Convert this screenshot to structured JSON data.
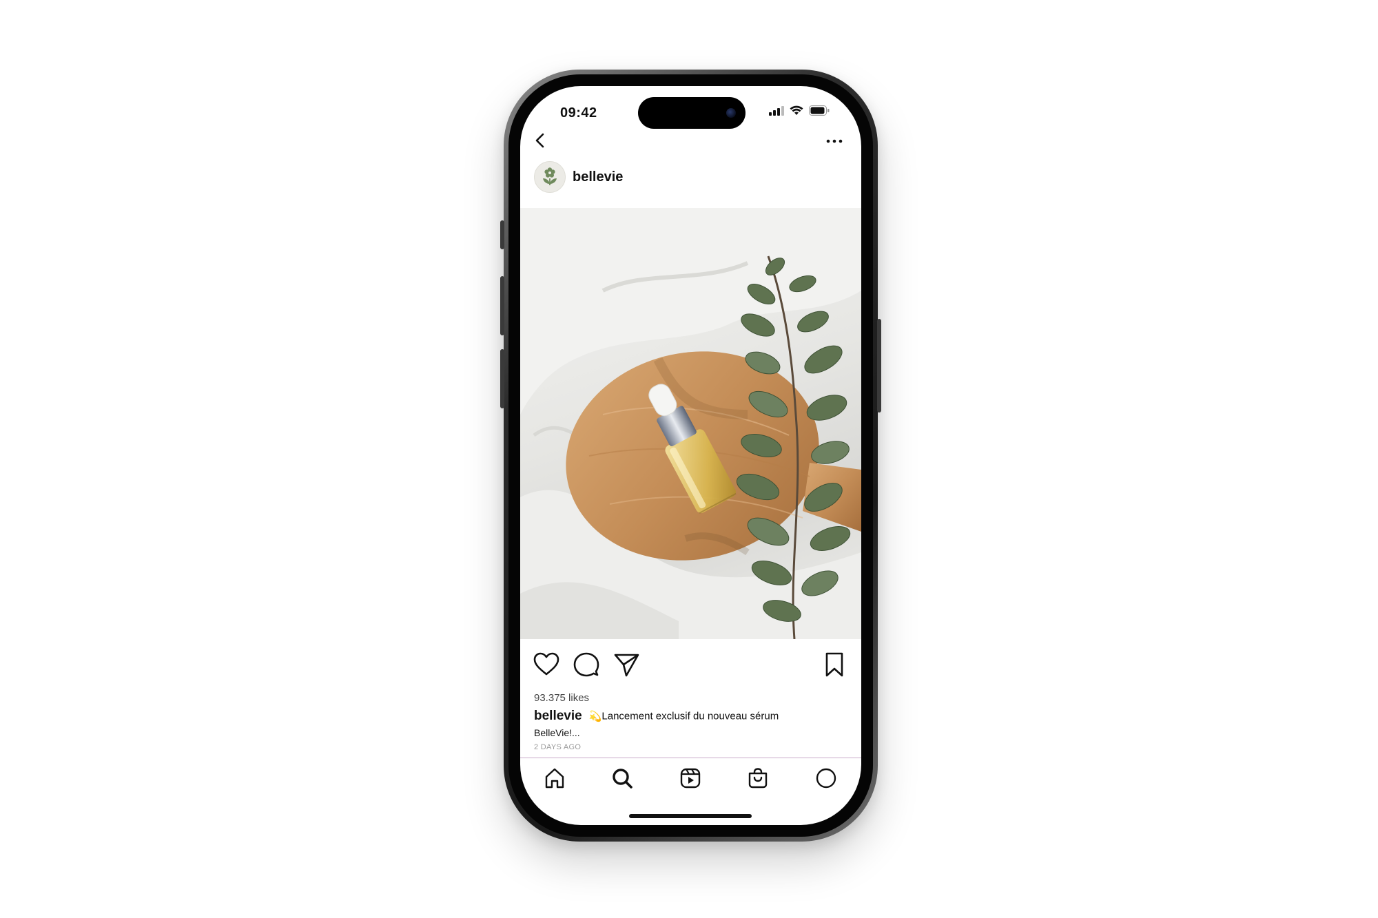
{
  "status_bar": {
    "time": "09:42"
  },
  "post": {
    "username": "bellevie",
    "likes": "93.375 likes",
    "caption_user": "bellevie",
    "caption_emoji": "💫",
    "caption_text": "Lancement exclusif du nouveau sérum",
    "caption_continuation": "BelleVie!...",
    "timestamp": "2 DAYS AGO"
  },
  "icons": {
    "back": "chevron-left-icon",
    "more": "more-horizontal-icon",
    "like": "heart-icon",
    "comment": "comment-icon",
    "share": "send-icon",
    "save": "bookmark-icon",
    "home": "home-icon",
    "search": "search-icon",
    "reels": "reels-icon",
    "shop": "shopping-bag-icon",
    "profile": "profile-icon"
  },
  "colors": {
    "avatar_green": "#6f8a5c",
    "divider": "#c9a9c9"
  }
}
